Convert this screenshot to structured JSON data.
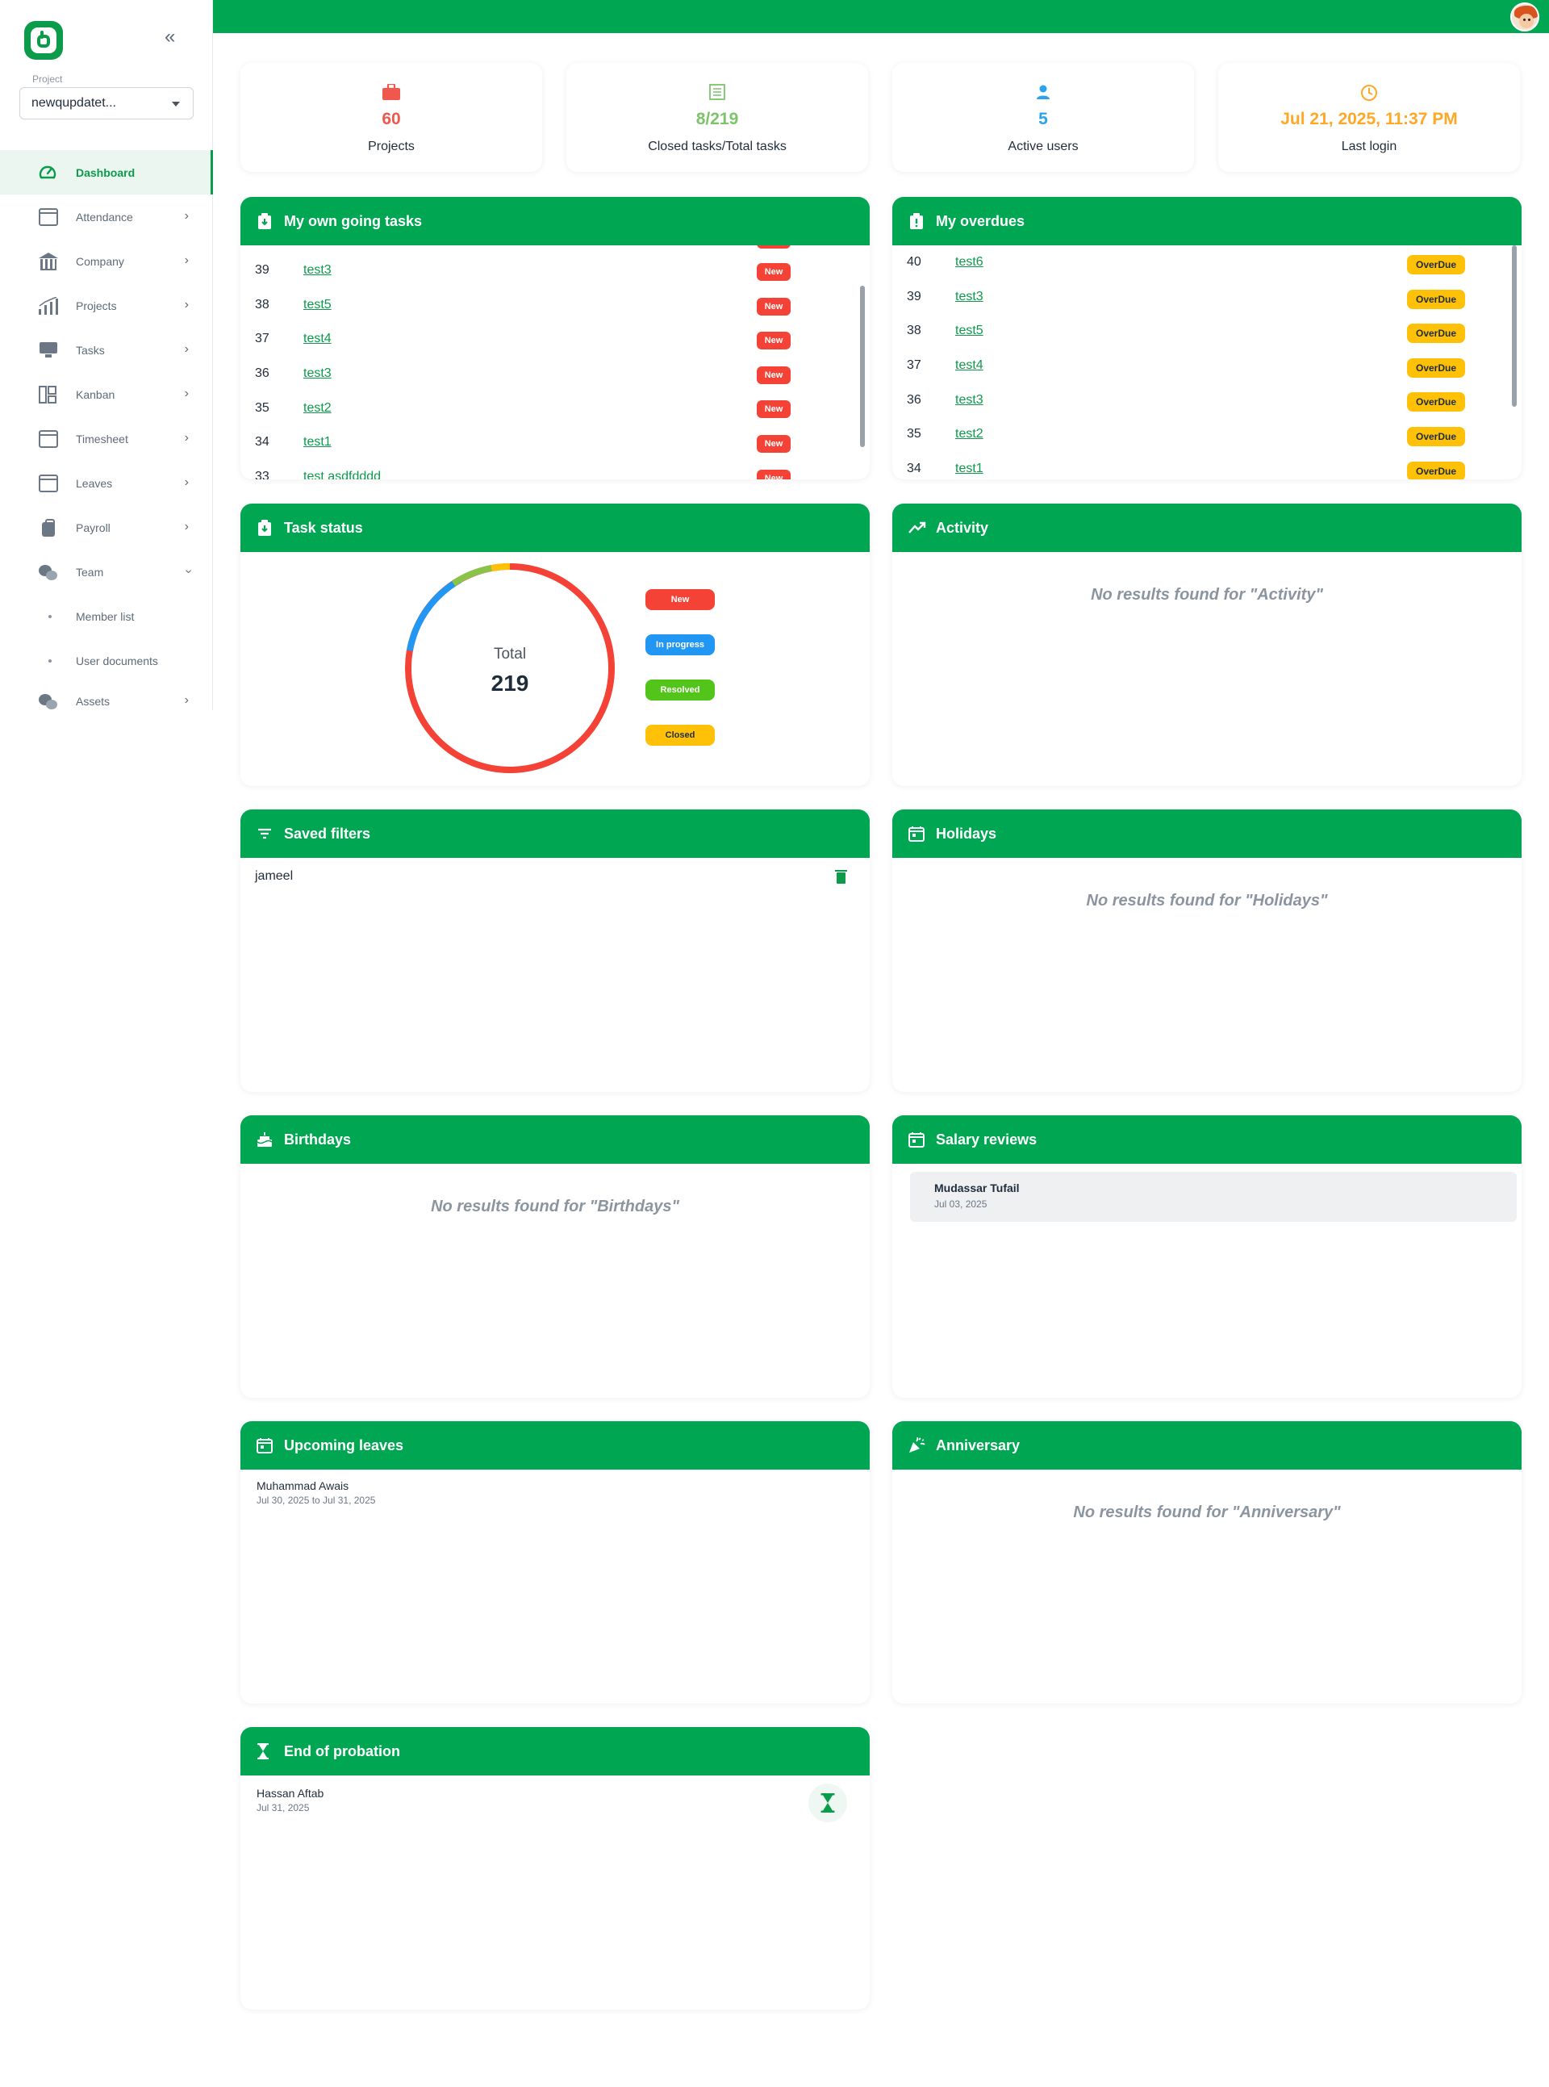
{
  "sidebar": {
    "project_label": "Project",
    "project_value": "newqupdatet...",
    "items": [
      {
        "label": "Dashboard",
        "icon": "dashboard-icon"
      },
      {
        "label": "Attendance",
        "icon": "calendar-icon"
      },
      {
        "label": "Company",
        "icon": "bank-icon"
      },
      {
        "label": "Projects",
        "icon": "bar-chart-icon"
      },
      {
        "label": "Tasks",
        "icon": "monitor-icon"
      },
      {
        "label": "Kanban",
        "icon": "kanban-icon"
      },
      {
        "label": "Timesheet",
        "icon": "calendar-check-icon"
      },
      {
        "label": "Leaves",
        "icon": "calendar-icon"
      },
      {
        "label": "Payroll",
        "icon": "bag-icon"
      },
      {
        "label": "Team",
        "icon": "team-icon"
      }
    ],
    "team_sub": [
      "Member list",
      "User documents"
    ],
    "assets_label": "Assets"
  },
  "stats": [
    {
      "value": "60",
      "label": "Projects",
      "color": "#f0584d",
      "icon": "briefcase-icon"
    },
    {
      "value": "8/219",
      "label": "Closed tasks/Total tasks",
      "color": "#7cc36a",
      "icon": "task-list-icon"
    },
    {
      "value": "5",
      "label": "Active users",
      "color": "#29a3f0",
      "icon": "user-icon"
    },
    {
      "value": "Jul 21, 2025, 11:37 PM",
      "label": "Last login",
      "color": "#ffa726",
      "icon": "clock-icon"
    }
  ],
  "ongoing": {
    "title": "My own going tasks",
    "badge": "New",
    "rows": [
      {
        "id": "39",
        "name": "test3"
      },
      {
        "id": "38",
        "name": "test5"
      },
      {
        "id": "37",
        "name": "test4"
      },
      {
        "id": "36",
        "name": "test3"
      },
      {
        "id": "35",
        "name": "test2"
      },
      {
        "id": "34",
        "name": "test1"
      },
      {
        "id": "33",
        "name": "test asdfdddd"
      }
    ]
  },
  "overdues": {
    "title": "My overdues",
    "badge": "OverDue",
    "rows": [
      {
        "id": "40",
        "name": "test6"
      },
      {
        "id": "39",
        "name": "test3"
      },
      {
        "id": "38",
        "name": "test5"
      },
      {
        "id": "37",
        "name": "test4"
      },
      {
        "id": "36",
        "name": "test3"
      },
      {
        "id": "35",
        "name": "test2"
      },
      {
        "id": "34",
        "name": "test1"
      }
    ]
  },
  "task_status": {
    "title": "Task status",
    "total_label": "Total",
    "total": "219",
    "legend": [
      {
        "label": "New",
        "color": "#f44336"
      },
      {
        "label": "In progress",
        "color": "#2196f3"
      },
      {
        "label": "Resolved",
        "color": "#52c41a"
      },
      {
        "label": "Closed",
        "color": "#ffc107"
      }
    ]
  },
  "activity": {
    "title": "Activity",
    "empty": "No results found for \"Activity\""
  },
  "saved_filters": {
    "title": "Saved filters",
    "items": [
      "jameel"
    ]
  },
  "holidays": {
    "title": "Holidays",
    "empty": "No results found for \"Holidays\""
  },
  "birthdays": {
    "title": "Birthdays",
    "empty": "No results found for \"Birthdays\""
  },
  "salary_reviews": {
    "title": "Salary reviews",
    "items": [
      {
        "name": "Mudassar Tufail",
        "date": "Jul 03, 2025"
      }
    ]
  },
  "upcoming_leaves": {
    "title": "Upcoming leaves",
    "items": [
      {
        "name": "Muhammad Awais",
        "date": "Jul 30, 2025 to Jul 31, 2025"
      }
    ]
  },
  "anniversary": {
    "title": "Anniversary",
    "empty": "No results found for \"Anniversary\""
  },
  "probation": {
    "title": "End of probation",
    "items": [
      {
        "name": "Hassan Aftab",
        "date": "Jul 31, 2025"
      }
    ]
  },
  "colors": {
    "brand": "#00a651",
    "link": "#0b9b4b"
  }
}
